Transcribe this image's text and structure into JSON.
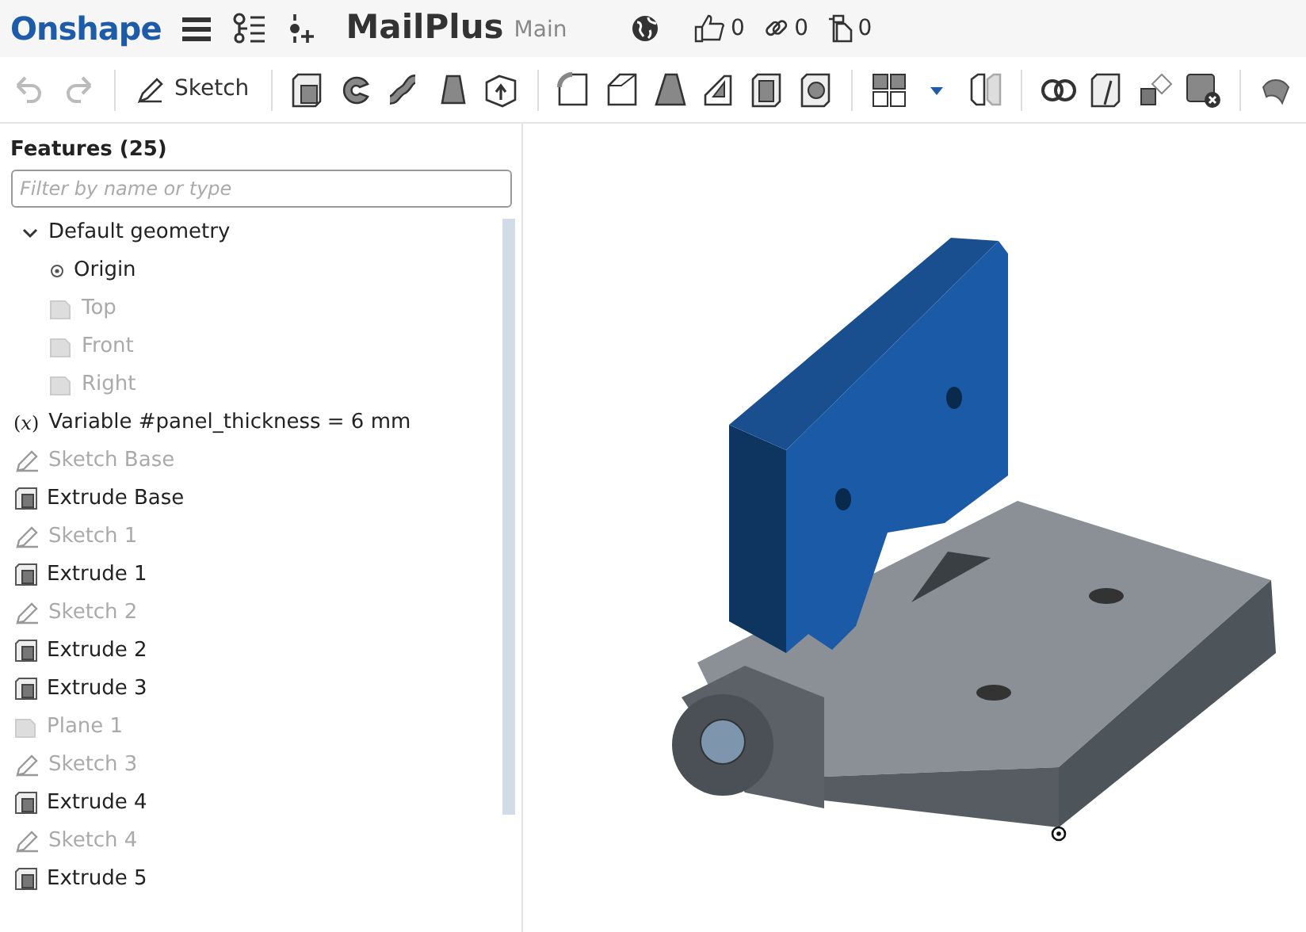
{
  "header": {
    "logo": "Onshape",
    "title": "MailPlus",
    "branch": "Main",
    "likes": "0",
    "links": "0",
    "copies": "0"
  },
  "toolbar": [
    {
      "kind": "undo",
      "disabled": true
    },
    {
      "kind": "redo",
      "disabled": true
    },
    {
      "kind": "sep"
    },
    {
      "kind": "sketch",
      "label": "Sketch"
    },
    {
      "kind": "sep"
    },
    {
      "kind": "extrude"
    },
    {
      "kind": "revolve"
    },
    {
      "kind": "sweep"
    },
    {
      "kind": "loft"
    },
    {
      "kind": "thicken"
    },
    {
      "kind": "sep"
    },
    {
      "kind": "fillet"
    },
    {
      "kind": "chamfer"
    },
    {
      "kind": "draft"
    },
    {
      "kind": "rib"
    },
    {
      "kind": "shell"
    },
    {
      "kind": "hole"
    },
    {
      "kind": "sep"
    },
    {
      "kind": "pattern"
    },
    {
      "kind": "caret"
    },
    {
      "kind": "mirror"
    },
    {
      "kind": "sep"
    },
    {
      "kind": "boolean"
    },
    {
      "kind": "split"
    },
    {
      "kind": "transform"
    },
    {
      "kind": "delete"
    },
    {
      "kind": "sep"
    },
    {
      "kind": "more"
    }
  ],
  "features": {
    "title": "Features (25)",
    "filter": {
      "placeholder": "Filter by name or type"
    },
    "items": [
      {
        "kind": "group",
        "label": "Default geometry",
        "expanded": true,
        "children": [
          {
            "kind": "origin",
            "label": "Origin",
            "hidden": false
          },
          {
            "kind": "plane",
            "label": "Top",
            "hidden": true
          },
          {
            "kind": "plane",
            "label": "Front",
            "hidden": true
          },
          {
            "kind": "plane",
            "label": "Right",
            "hidden": true
          }
        ]
      },
      {
        "kind": "variable",
        "symbol": "(𝑥)",
        "label": "Variable #panel_thickness = 6 mm",
        "hidden": false
      },
      {
        "kind": "sketch",
        "label": "Sketch Base",
        "hidden": true
      },
      {
        "kind": "extrude",
        "label": "Extrude Base",
        "hidden": false
      },
      {
        "kind": "sketch",
        "label": "Sketch 1",
        "hidden": true
      },
      {
        "kind": "extrude",
        "label": "Extrude 1",
        "hidden": false
      },
      {
        "kind": "sketch",
        "label": "Sketch 2",
        "hidden": true
      },
      {
        "kind": "extrude",
        "label": "Extrude 2",
        "hidden": false
      },
      {
        "kind": "extrude",
        "label": "Extrude 3",
        "hidden": false
      },
      {
        "kind": "plane",
        "label": "Plane 1",
        "hidden": true
      },
      {
        "kind": "sketch",
        "label": "Sketch 3",
        "hidden": true
      },
      {
        "kind": "extrude",
        "label": "Extrude 4",
        "hidden": false
      },
      {
        "kind": "sketch",
        "label": "Sketch 4",
        "hidden": true
      },
      {
        "kind": "extrude",
        "label": "Extrude 5",
        "hidden": false
      }
    ]
  }
}
